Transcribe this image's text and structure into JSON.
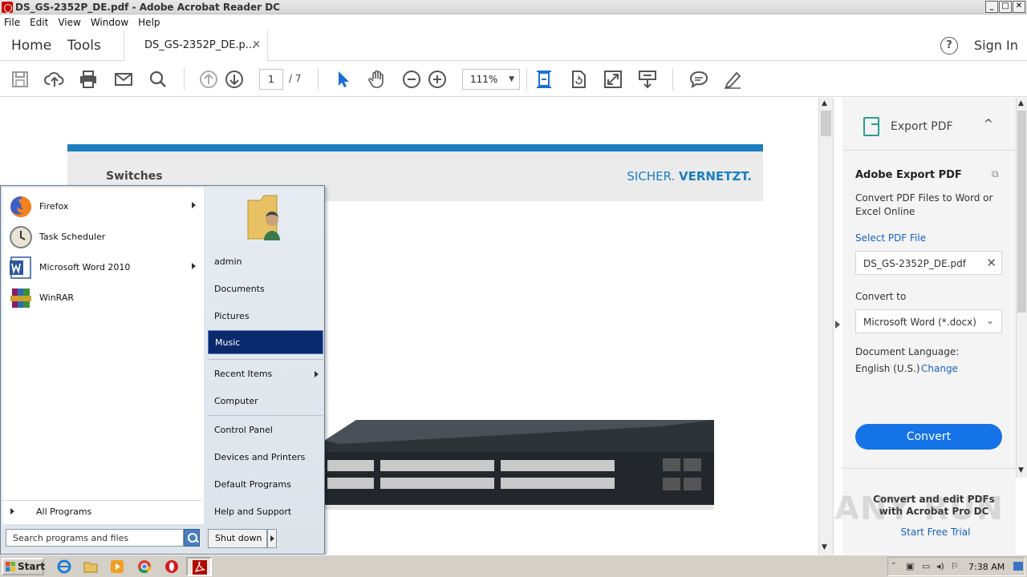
{
  "window": {
    "title": "DS_GS-2352P_DE.pdf - Adobe Acrobat Reader DC",
    "buttons": [
      "_",
      "□",
      "✕"
    ]
  },
  "menu": [
    "File",
    "Edit",
    "View",
    "Window",
    "Help"
  ],
  "tabs": {
    "home": "Home",
    "tools": "Tools",
    "document": "DS_GS-2352P_DE.p...",
    "close": "×",
    "help": "?",
    "signin": "Sign In"
  },
  "toolbar": {
    "page_current": "1",
    "page_total": "/ 7",
    "zoom": "111%",
    "zoom_caret": "▼"
  },
  "pdf": {
    "category": "Switches",
    "slogan_plain": "SICHER.",
    "slogan_bold": "VERNETZT."
  },
  "export_pane": {
    "header": "Export PDF",
    "chevron": "^",
    "title": "Adobe Export PDF",
    "description": "Convert PDF Files to Word or Excel Online",
    "select_label": "Select PDF File",
    "file_name": "DS_GS-2352P_DE.pdf",
    "clear": "✕",
    "convert_to_label": "Convert to",
    "convert_to_value": "Microsoft Word (*.docx)",
    "convert_chevron": "⌄",
    "language_label": "Document Language:",
    "language_value": "English (U.S.)",
    "change_link": "Change",
    "convert_button": "Convert",
    "promo_text": "Convert and edit PDFs with Acrobat Pro DC",
    "trial_link": "Start Free Trial",
    "watermark": "ANY RUN"
  },
  "start_menu": {
    "programs": [
      {
        "label": "Firefox",
        "has_submenu": true
      },
      {
        "label": "Task Scheduler",
        "has_submenu": false
      },
      {
        "label": "Microsoft Word 2010",
        "has_submenu": true
      },
      {
        "label": "WinRAR",
        "has_submenu": false
      }
    ],
    "all_programs": "All Programs",
    "search_placeholder": "Search programs and files",
    "right_links": {
      "admin": "admin",
      "documents": "Documents",
      "pictures": "Pictures",
      "music": "Music",
      "recent_items": "Recent Items",
      "computer": "Computer",
      "control_panel": "Control Panel",
      "devices": "Devices and Printers",
      "default_programs": "Default Programs",
      "help": "Help and Support"
    },
    "selected": "Music",
    "shutdown": "Shut down"
  },
  "taskbar": {
    "start": "Start",
    "clock": "7:38 AM"
  },
  "colors": {
    "acrobat_blue": "#1473e6",
    "pdf_blue": "#1a7fc1",
    "start_selected": "#0b2a6e"
  }
}
